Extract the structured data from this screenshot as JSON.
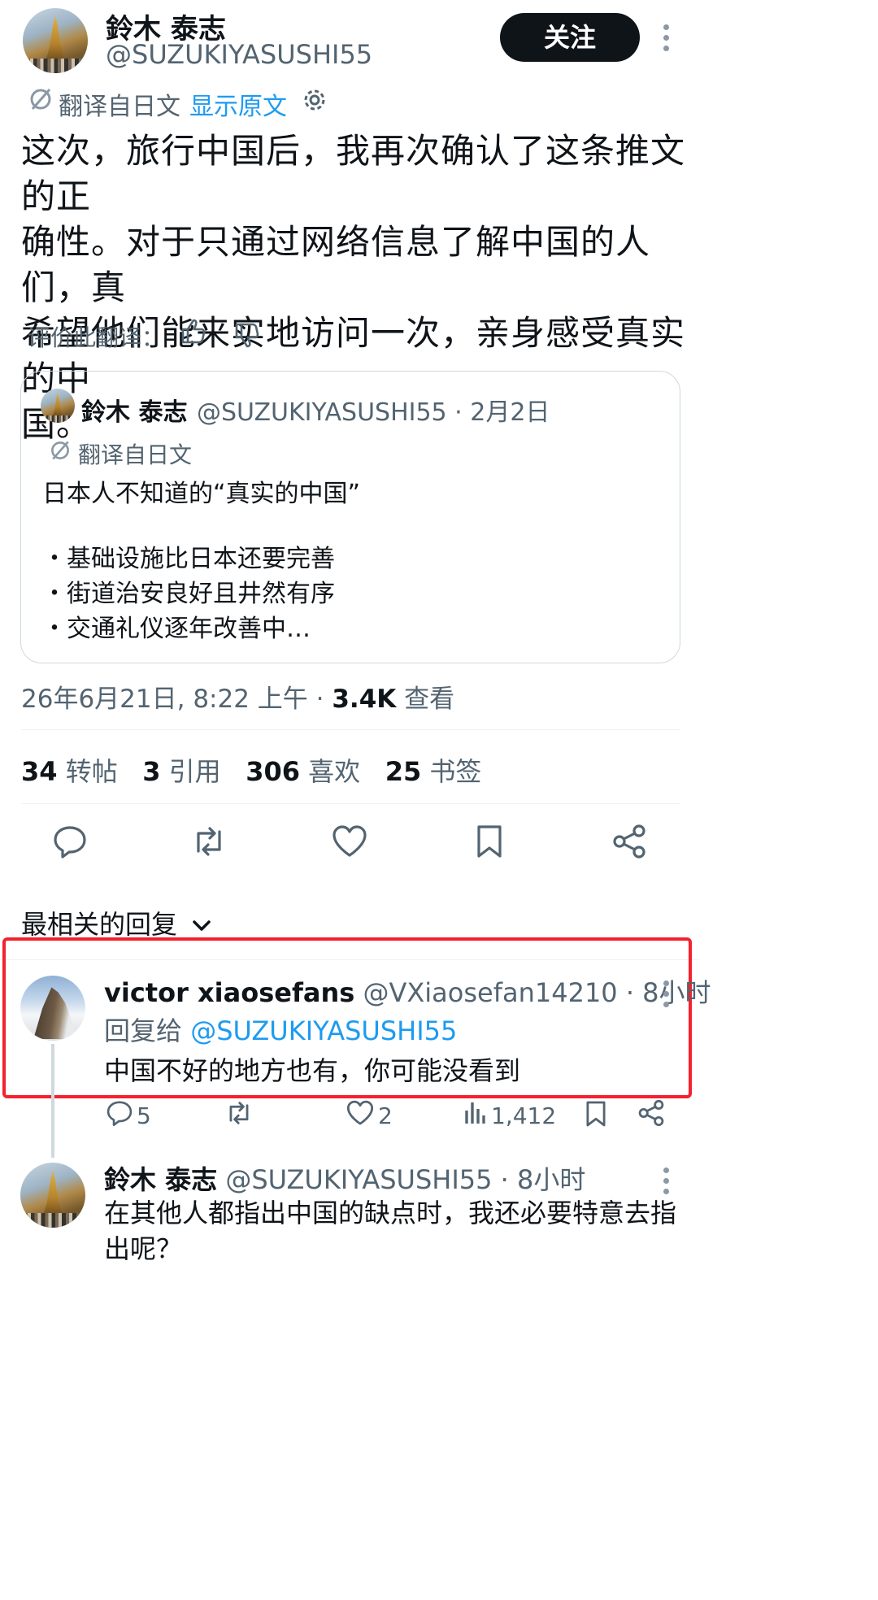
{
  "author": {
    "name": "鈴木 泰志",
    "handle": "@SUZUKIYASUSHI55",
    "follow_label": "关注"
  },
  "translation": {
    "label": "翻译自日文",
    "show_original": "显示原文"
  },
  "post": {
    "text_lines": [
      "这次，旅行中国后，我再次确认了这条推文的正",
      "确性。对于只通过网络信息了解中国的人们，真",
      "希望他们能来实地访问一次，亲身感受真实的中",
      "国。"
    ],
    "rate_translation": "评价此翻译："
  },
  "quote": {
    "name": "鈴木 泰志",
    "handle_time": "@SUZUKIYASUSHI55 · 2月2日",
    "translation_label": "翻译自日文",
    "title": "日本人不知道的“真实的中国”",
    "bullets": [
      "・基础设施比日本还要完善",
      "・街道治安良好且井然有序",
      "・交通礼仪逐年改善中…"
    ]
  },
  "meta": {
    "datetime": "26年6月21日, 8:22 上午 · ",
    "views_num": "3.4K",
    "views_label": " 查看"
  },
  "stats": [
    {
      "num": "34",
      "label": "转帖"
    },
    {
      "num": "3",
      "label": "引用"
    },
    {
      "num": "306",
      "label": "喜欢"
    },
    {
      "num": "25",
      "label": "书签"
    }
  ],
  "replies_header": "最相关的回复",
  "reply1": {
    "name": "victor xiaosefans",
    "handle_time": " @VXiaosefan14210 · 8小时",
    "reply_to_prefix": "回复给 ",
    "reply_to_handle": "@SUZUKIYASUSHI55",
    "text": "中国不好的地方也有，你可能没看到",
    "comments": "5",
    "likes": "2",
    "views": "1,412"
  },
  "reply2": {
    "name": "鈴木 泰志",
    "handle_time": " @SUZUKIYASUSHI55 · 8小时",
    "text_lines": [
      "在其他人都指出中国的缺点时，我还必要特意去指",
      "出呢？"
    ]
  },
  "colors": {
    "text": "#0f1419",
    "secondary": "#536471",
    "link": "#1d9bf0",
    "highlight_box": "#f4212e"
  }
}
